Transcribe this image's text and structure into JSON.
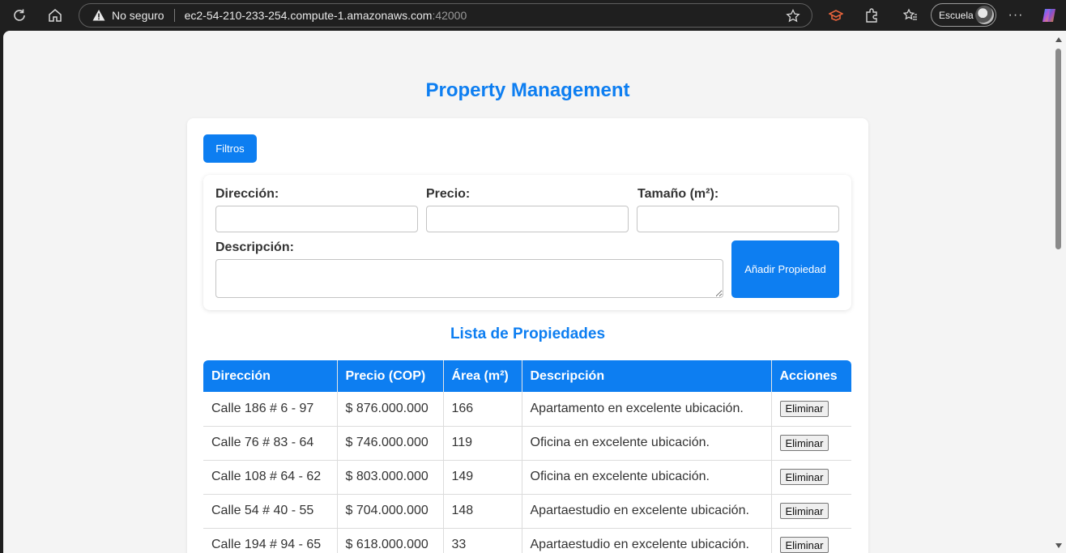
{
  "browser": {
    "security_label": "No seguro",
    "url_host": "ec2-54-210-233-254.compute-1.amazonaws.com",
    "url_port": ":42000",
    "profile_label": "Escuela"
  },
  "page": {
    "title": "Property Management",
    "filters_label": "Filtros",
    "accent_color": "#0d7ef1"
  },
  "form": {
    "address_label": "Dirección:",
    "price_label": "Precio:",
    "size_label": "Tamaño (m²):",
    "description_label": "Descripción:",
    "address_value": "",
    "price_value": "",
    "size_value": "",
    "description_value": "",
    "add_button": "Añadir Propiedad"
  },
  "list": {
    "title": "Lista de Propiedades",
    "columns": [
      "Dirección",
      "Precio (COP)",
      "Área (m²)",
      "Descripción",
      "Acciones"
    ],
    "delete_label": "Eliminar",
    "rows": [
      {
        "address": "Calle 186 # 6 - 97",
        "price": "$ 876.000.000",
        "area": "166",
        "description": "Apartamento en excelente ubicación."
      },
      {
        "address": "Calle 76 # 83 - 64",
        "price": "$ 746.000.000",
        "area": "119",
        "description": "Oficina en excelente ubicación."
      },
      {
        "address": "Calle 108 # 64 - 62",
        "price": "$ 803.000.000",
        "area": "149",
        "description": "Oficina en excelente ubicación."
      },
      {
        "address": "Calle 54 # 40 - 55",
        "price": "$ 704.000.000",
        "area": "148",
        "description": "Apartaestudio en excelente ubicación."
      },
      {
        "address": "Calle 194 # 94 - 65",
        "price": "$ 618.000.000",
        "area": "33",
        "description": "Apartaestudio en excelente ubicación."
      }
    ]
  }
}
